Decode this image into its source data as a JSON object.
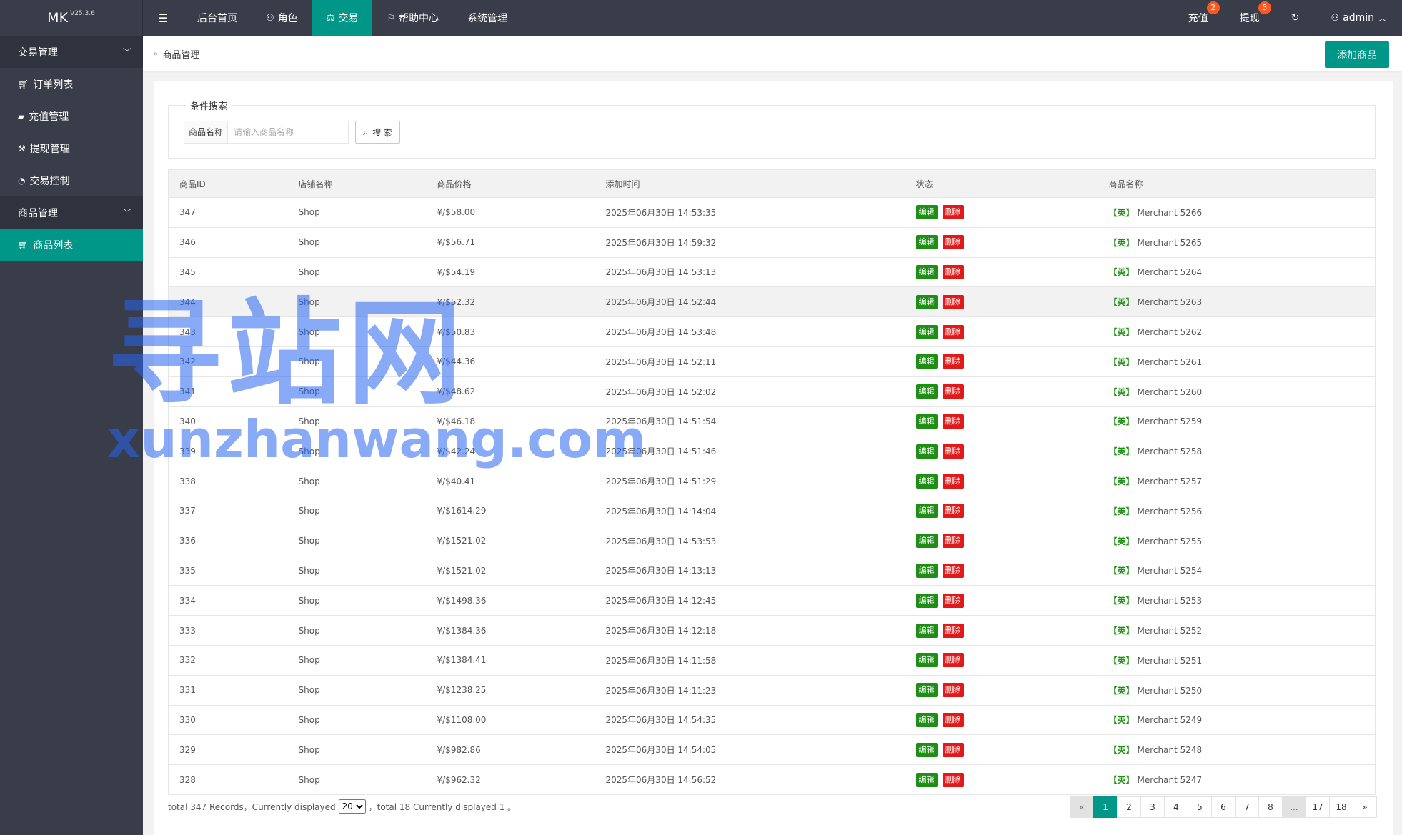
{
  "topbar": {
    "brand": "MK",
    "version": "V25.3.6",
    "nav": [
      {
        "label": "后台首页",
        "icon": ""
      },
      {
        "label": "角色",
        "icon": "user-icon"
      },
      {
        "label": "交易",
        "icon": "scale-icon"
      },
      {
        "label": "帮助中心",
        "icon": "flag-icon"
      },
      {
        "label": "系统管理",
        "icon": ""
      }
    ],
    "recharge_label": "充值",
    "recharge_badge": "2",
    "withdraw_label": "提现",
    "withdraw_badge": "5",
    "user_label": "admin"
  },
  "sidebar": {
    "group1": "交易管理",
    "items1": [
      "订单列表",
      "充值管理",
      "提现管理",
      "交易控制"
    ],
    "group2": "商品管理",
    "items2": [
      "商品列表"
    ]
  },
  "breadcrumb": "商品管理",
  "add_button": "添加商品",
  "search": {
    "legend": "条件搜索",
    "label": "商品名称",
    "placeholder": "请输入商品名称",
    "button": "搜 索"
  },
  "table": {
    "headers": [
      "商品ID",
      "店铺名称",
      "商品价格",
      "添加时间",
      "状态",
      "商品名称"
    ],
    "edit_label": "编辑",
    "delete_label": "删除",
    "tag": "【英】",
    "rows": [
      [
        "347",
        "Shop",
        "¥/$58.00",
        "2025年06月30日 14:53:35",
        "Merchant 5266"
      ],
      [
        "346",
        "Shop",
        "¥/$56.71",
        "2025年06月30日 14:59:32",
        "Merchant 5265"
      ],
      [
        "345",
        "Shop",
        "¥/$54.19",
        "2025年06月30日 14:53:13",
        "Merchant 5264"
      ],
      [
        "344",
        "Shop",
        "¥/$52.32",
        "2025年06月30日 14:52:44",
        "Merchant 5263"
      ],
      [
        "343",
        "Shop",
        "¥/$50.83",
        "2025年06月30日 14:53:48",
        "Merchant 5262"
      ],
      [
        "342",
        "Shop",
        "¥/$44.36",
        "2025年06月30日 14:52:11",
        "Merchant 5261"
      ],
      [
        "341",
        "Shop",
        "¥/$48.62",
        "2025年06月30日 14:52:02",
        "Merchant 5260"
      ],
      [
        "340",
        "Shop",
        "¥/$46.18",
        "2025年06月30日 14:51:54",
        "Merchant 5259"
      ],
      [
        "339",
        "Shop",
        "¥/$42.24",
        "2025年06月30日 14:51:46",
        "Merchant 5258"
      ],
      [
        "338",
        "Shop",
        "¥/$40.41",
        "2025年06月30日 14:51:29",
        "Merchant 5257"
      ],
      [
        "337",
        "Shop",
        "¥/$1614.29",
        "2025年06月30日 14:14:04",
        "Merchant 5256"
      ],
      [
        "336",
        "Shop",
        "¥/$1521.02",
        "2025年06月30日 14:53:53",
        "Merchant 5255"
      ],
      [
        "335",
        "Shop",
        "¥/$1521.02",
        "2025年06月30日 14:13:13",
        "Merchant 5254"
      ],
      [
        "334",
        "Shop",
        "¥/$1498.36",
        "2025年06月30日 14:12:45",
        "Merchant 5253"
      ],
      [
        "333",
        "Shop",
        "¥/$1384.36",
        "2025年06月30日 14:12:18",
        "Merchant 5252"
      ],
      [
        "332",
        "Shop",
        "¥/$1384.41",
        "2025年06月30日 14:11:58",
        "Merchant 5251"
      ],
      [
        "331",
        "Shop",
        "¥/$1238.25",
        "2025年06月30日 14:11:23",
        "Merchant 5250"
      ],
      [
        "330",
        "Shop",
        "¥/$1108.00",
        "2025年06月30日 14:54:35",
        "Merchant 5249"
      ],
      [
        "329",
        "Shop",
        "¥/$982.86",
        "2025年06月30日 14:54:05",
        "Merchant 5248"
      ],
      [
        "328",
        "Shop",
        "¥/$962.32",
        "2025年06月30日 14:56:52",
        "Merchant 5247"
      ]
    ]
  },
  "footer": {
    "prefix": "total 347 Records，Currently displayed",
    "page_size": "20",
    "suffix": "，total 18 Currently displayed 1 。"
  },
  "pager": [
    "«",
    "1",
    "2",
    "3",
    "4",
    "5",
    "6",
    "7",
    "8",
    "...",
    "17",
    "18",
    "»"
  ],
  "watermark": {
    "cn": "寻站网",
    "en": "xunzhanwang.com"
  }
}
